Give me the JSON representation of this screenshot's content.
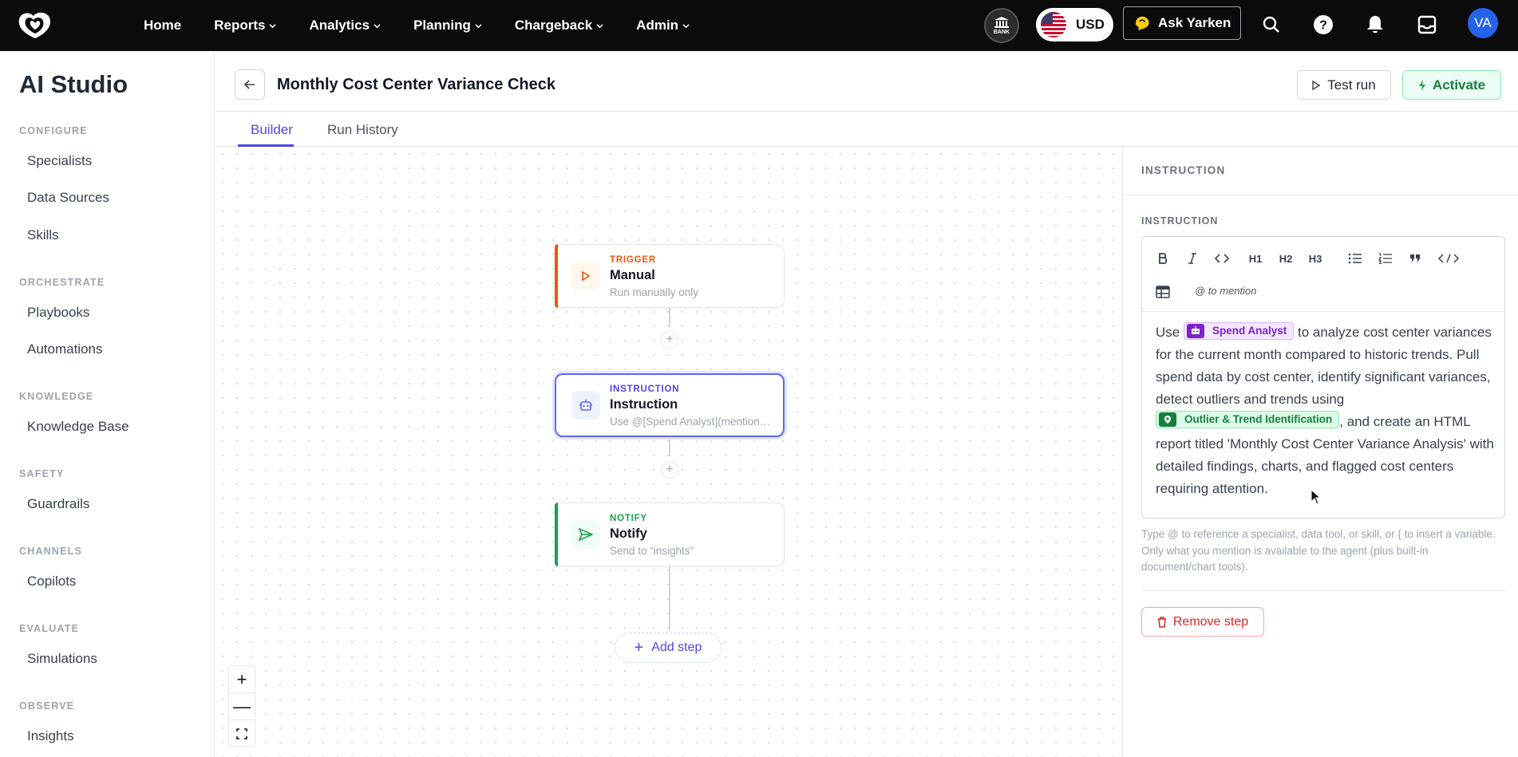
{
  "topbar": {
    "nav": [
      "Home",
      "Reports",
      "Analytics",
      "Planning",
      "Chargeback",
      "Admin"
    ],
    "bank_label": "BANK",
    "currency": "USD",
    "ask_label": "Ask Yarken",
    "avatar_initials": "VA"
  },
  "sidebar": {
    "title": "AI Studio",
    "sections": {
      "configure": "CONFIGURE",
      "orchestrate": "ORCHESTRATE",
      "knowledge": "KNOWLEDGE",
      "safety": "SAFETY",
      "channels": "CHANNELS",
      "evaluate": "EVALUATE",
      "observe": "OBSERVE"
    },
    "items": {
      "specialists": "Specialists",
      "data_sources": "Data Sources",
      "skills": "Skills",
      "playbooks": "Playbooks",
      "automations": "Automations",
      "knowledge_base": "Knowledge Base",
      "guardrails": "Guardrails",
      "copilots": "Copilots",
      "simulations": "Simulations",
      "insights": "Insights"
    }
  },
  "header": {
    "title": "Monthly Cost Center Variance Check",
    "test_run_label": "Test run",
    "activate_label": "Activate"
  },
  "tabs": [
    "Builder",
    "Run History"
  ],
  "flow": {
    "nodes": [
      {
        "type": "TRIGGER",
        "name": "Manual",
        "desc": "Run manually only"
      },
      {
        "type": "INSTRUCTION",
        "name": "Instruction",
        "desc": "Use @[Spend Analyst](mention:specialist)"
      },
      {
        "type": "NOTIFY",
        "name": "Notify",
        "desc": "Send to “insights”"
      }
    ],
    "add_step_label": "Add step"
  },
  "panel": {
    "heading": "INSTRUCTION",
    "field_label": "INSTRUCTION",
    "toolbar": {
      "h1": "H1",
      "h2": "H2",
      "h3": "H3",
      "mention_hint": "@ to mention"
    },
    "body": {
      "t1": "Use",
      "chip1": "Spend Analyst",
      "t2": "to analyze cost center variances for the current month compared to historic trends. Pull spend data by cost center, identify significant variances, detect outliers and trends using",
      "chip2": "Outlier & Trend Identification",
      "t3": ", and create an HTML report titled 'Monthly Cost Center Variance Analysis' with detailed findings, charts, and flagged cost centers requiring attention."
    },
    "help": "Type @ to reference a specialist, data tool, or skill, or { to insert a variable. Only what you mention is available to the agent (plus built-in document/chart tools).",
    "remove_label": "Remove step"
  },
  "colors": {
    "accent": "#4f46e5",
    "trigger": "#ea580c",
    "instruction": "#6366f1",
    "notify": "#16a34a",
    "danger": "#dc2626"
  }
}
